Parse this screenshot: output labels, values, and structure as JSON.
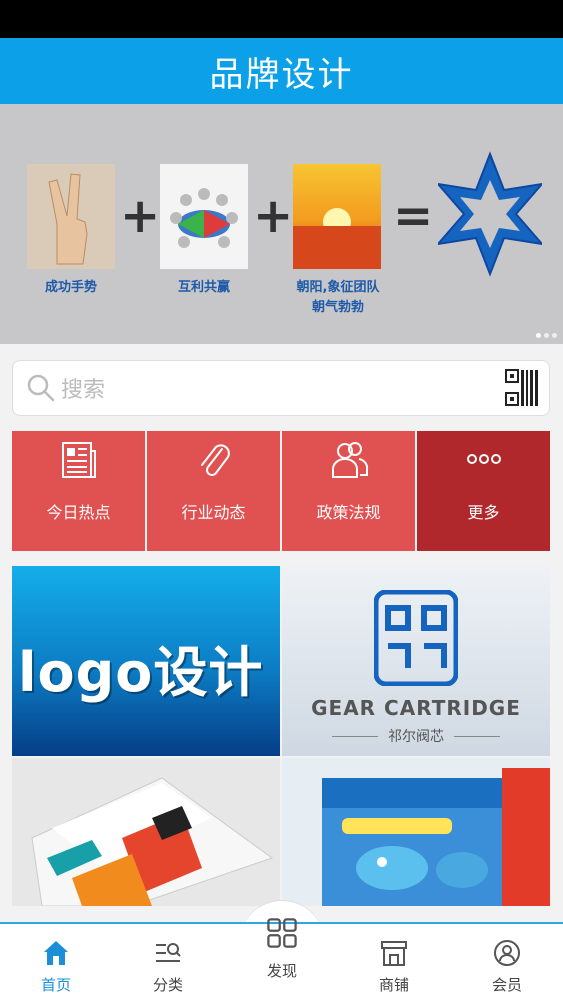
{
  "header": {
    "title": "品牌设计"
  },
  "banner": {
    "items": [
      {
        "caption": "成功手势",
        "icon": "victory-hand-icon"
      },
      {
        "caption": "互利共赢",
        "icon": "people-circle-icon"
      },
      {
        "caption_line1": "朝阳,象征团队",
        "caption_line2": "朝气勃勃",
        "icon": "sunrise-icon"
      }
    ],
    "plus": "+",
    "equals": "=",
    "slide_count": 3,
    "active_slide": 1
  },
  "search": {
    "placeholder": "搜索",
    "icon": "search-icon",
    "scan_icon": "qr-scan-icon"
  },
  "quick_nav": [
    {
      "label": "今日热点",
      "icon": "newspaper-icon"
    },
    {
      "label": "行业动态",
      "icon": "paperclip-icon"
    },
    {
      "label": "政策法规",
      "icon": "people-icon"
    },
    {
      "label": "更多",
      "icon": "more-dots-icon"
    }
  ],
  "products": {
    "p1_text": "logo设计",
    "p2_name": "GEAR CARTRIDGE",
    "p2_sub": "祁尔阀芯"
  },
  "tabbar": {
    "items": [
      {
        "label": "首页",
        "icon": "home-icon",
        "active": true
      },
      {
        "label": "分类",
        "icon": "category-list-icon",
        "active": false
      },
      {
        "label": "发现",
        "icon": "grid-icon",
        "active": false
      },
      {
        "label": "商铺",
        "icon": "storefront-icon",
        "active": false
      },
      {
        "label": "会员",
        "icon": "user-icon",
        "active": false
      }
    ]
  },
  "colors": {
    "header": "#0ba0e8",
    "nav_red": "#e05252",
    "nav_dark_red": "#b0282c",
    "tab_active": "#1a8fd8"
  }
}
